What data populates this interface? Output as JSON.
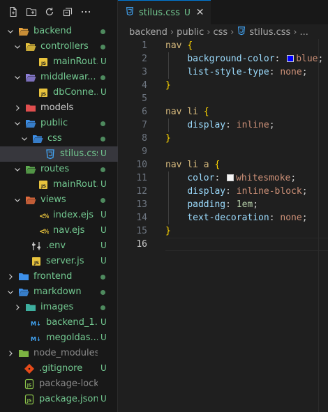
{
  "explorer": {
    "items": [
      {
        "label": "backend",
        "kind": "folder-open",
        "color": "#e8a33d",
        "depth": 0,
        "chevron": "down",
        "status": "dot"
      },
      {
        "label": "controllers",
        "kind": "folder-open",
        "color": "#e8c33d",
        "depth": 1,
        "chevron": "down",
        "status": "dot"
      },
      {
        "label": "mainRout...",
        "kind": "js",
        "depth": 2,
        "status": "U"
      },
      {
        "label": "middlewar...",
        "kind": "folder-open",
        "color": "#8d7fd8",
        "depth": 1,
        "chevron": "down",
        "status": "dot"
      },
      {
        "label": "dbConne...",
        "kind": "js",
        "depth": 2,
        "status": "U"
      },
      {
        "label": "models",
        "kind": "folder",
        "color": "#e04e4e",
        "depth": 1,
        "chevron": "right",
        "status": "",
        "plain": true
      },
      {
        "label": "public",
        "kind": "folder-open",
        "color": "#3d8fe8",
        "depth": 1,
        "chevron": "down",
        "status": "dot"
      },
      {
        "label": "css",
        "kind": "folder-open",
        "color": "#3d8fe8",
        "depth": 2,
        "chevron": "down",
        "status": "dot"
      },
      {
        "label": "stilus.css",
        "kind": "css",
        "depth": 3,
        "status": "U",
        "selected": true
      },
      {
        "label": "routes",
        "kind": "folder-open",
        "color": "#5dab4f",
        "depth": 1,
        "chevron": "down",
        "status": "dot"
      },
      {
        "label": "mainRout...",
        "kind": "js",
        "depth": 2,
        "status": "U"
      },
      {
        "label": "views",
        "kind": "folder-open",
        "color": "#e06a3d",
        "depth": 1,
        "chevron": "down",
        "status": "dot"
      },
      {
        "label": "index.ejs",
        "kind": "ejs",
        "depth": 2,
        "status": "U"
      },
      {
        "label": "nav.ejs",
        "kind": "ejs",
        "depth": 2,
        "status": "U"
      },
      {
        "label": ".env",
        "kind": "env",
        "depth": 1,
        "status": "U"
      },
      {
        "label": "server.js",
        "kind": "js",
        "depth": 1,
        "status": "U"
      },
      {
        "label": "frontend",
        "kind": "folder",
        "color": "#3d8fe8",
        "depth": 0,
        "chevron": "right",
        "status": "dot"
      },
      {
        "label": "markdown",
        "kind": "folder-open",
        "color": "#3d8fe8",
        "depth": 0,
        "chevron": "down",
        "status": "dot"
      },
      {
        "label": "images",
        "kind": "folder",
        "color": "#3dae9e",
        "depth": 1,
        "chevron": "right",
        "status": "dot"
      },
      {
        "label": "backend_1....",
        "kind": "md",
        "depth": 1,
        "status": "U"
      },
      {
        "label": "megoldas....",
        "kind": "md",
        "depth": 1,
        "status": "U"
      },
      {
        "label": "node_modules",
        "kind": "folder",
        "color": "#7cb342",
        "depth": 0,
        "chevron": "right",
        "status": "",
        "dim": true
      },
      {
        "label": ".gitignore",
        "kind": "git",
        "depth": 0,
        "status": "U"
      },
      {
        "label": "package-lock.json",
        "kind": "json",
        "depth": 0,
        "status": "",
        "dim": true
      },
      {
        "label": "package.json",
        "kind": "json",
        "depth": 0,
        "status": "U"
      }
    ]
  },
  "tab": {
    "label": "stilus.css",
    "badge": "U",
    "close": "✕"
  },
  "breadcrumb": [
    "backend",
    "public",
    "css",
    "stilus.css",
    "..."
  ],
  "code": {
    "current_line": 16,
    "lines": [
      [
        {
          "t": "nav",
          "c": "sel"
        },
        {
          "t": " ",
          "c": "punc"
        },
        {
          "t": "{",
          "c": "brace"
        }
      ],
      [
        {
          "t": "    "
        },
        {
          "t": "background-color",
          "c": "prop"
        },
        {
          "t": ": ",
          "c": "punc"
        },
        {
          "swatch": "#0000ff"
        },
        {
          "t": "blue",
          "c": "val"
        },
        {
          "t": ";",
          "c": "punc"
        }
      ],
      [
        {
          "t": "    "
        },
        {
          "t": "list-style-type",
          "c": "prop"
        },
        {
          "t": ": ",
          "c": "punc"
        },
        {
          "t": "none",
          "c": "val"
        },
        {
          "t": ";",
          "c": "punc"
        }
      ],
      [
        {
          "t": "}",
          "c": "brace"
        }
      ],
      [],
      [
        {
          "t": "nav li",
          "c": "sel"
        },
        {
          "t": " ",
          "c": "punc"
        },
        {
          "t": "{",
          "c": "brace"
        }
      ],
      [
        {
          "t": "    "
        },
        {
          "t": "display",
          "c": "prop"
        },
        {
          "t": ": ",
          "c": "punc"
        },
        {
          "t": "inline",
          "c": "val"
        },
        {
          "t": ";",
          "c": "punc"
        }
      ],
      [
        {
          "t": "}",
          "c": "brace"
        }
      ],
      [],
      [
        {
          "t": "nav li a",
          "c": "sel"
        },
        {
          "t": " ",
          "c": "punc"
        },
        {
          "t": "{",
          "c": "brace"
        }
      ],
      [
        {
          "t": "    "
        },
        {
          "t": "color",
          "c": "prop"
        },
        {
          "t": ": ",
          "c": "punc"
        },
        {
          "swatch": "#f5f5f5"
        },
        {
          "t": "whitesmoke",
          "c": "val"
        },
        {
          "t": ";",
          "c": "punc"
        }
      ],
      [
        {
          "t": "    "
        },
        {
          "t": "display",
          "c": "prop"
        },
        {
          "t": ": ",
          "c": "punc"
        },
        {
          "t": "inline-block",
          "c": "val"
        },
        {
          "t": ";",
          "c": "punc"
        }
      ],
      [
        {
          "t": "    "
        },
        {
          "t": "padding",
          "c": "prop"
        },
        {
          "t": ": ",
          "c": "punc"
        },
        {
          "t": "1em",
          "c": "num"
        },
        {
          "t": ";",
          "c": "punc"
        }
      ],
      [
        {
          "t": "    "
        },
        {
          "t": "text-decoration",
          "c": "prop"
        },
        {
          "t": ": ",
          "c": "punc"
        },
        {
          "t": "none",
          "c": "val"
        },
        {
          "t": ";",
          "c": "punc"
        }
      ],
      [
        {
          "t": "}",
          "c": "brace"
        }
      ],
      []
    ]
  }
}
